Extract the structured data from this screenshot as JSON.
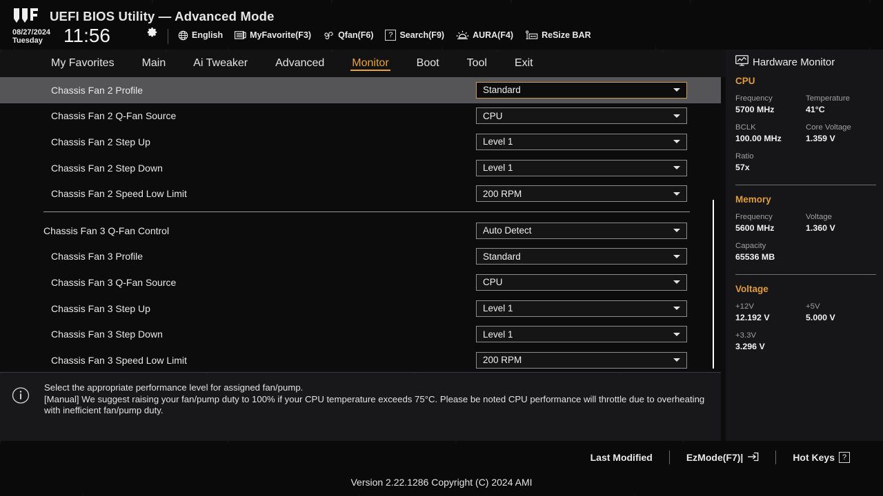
{
  "header": {
    "logo": "tuf-logo",
    "title": "UEFI BIOS Utility — Advanced Mode",
    "date": "08/27/2024",
    "day": "Tuesday",
    "time": "11:56",
    "gear_icon": "gear-icon",
    "items": [
      {
        "icon": "globe-icon",
        "label": "English"
      },
      {
        "icon": "list-icon",
        "label": "MyFavorite(F3)"
      },
      {
        "icon": "fan-icon",
        "label": "Qfan(F6)"
      },
      {
        "icon": "question-icon",
        "label": "Search(F9)"
      },
      {
        "icon": "aura-icon",
        "label": "AURA(F4)"
      },
      {
        "icon": "resizebar-icon",
        "label": "ReSize BAR"
      }
    ]
  },
  "nav": {
    "tabs": [
      {
        "label": "My Favorites",
        "active": false
      },
      {
        "label": "Main",
        "active": false
      },
      {
        "label": "Ai Tweaker",
        "active": false
      },
      {
        "label": "Advanced",
        "active": false
      },
      {
        "label": "Monitor",
        "active": true
      },
      {
        "label": "Boot",
        "active": false
      },
      {
        "label": "Tool",
        "active": false
      },
      {
        "label": "Exit",
        "active": false
      }
    ],
    "active_color": "#e8a33d"
  },
  "settings": {
    "group1": [
      {
        "label": "Chassis Fan 2 Profile",
        "value": "Standard",
        "indent": 1,
        "selected": true
      },
      {
        "label": "Chassis Fan 2 Q-Fan Source",
        "value": "CPU",
        "indent": 1,
        "selected": false
      },
      {
        "label": "Chassis Fan 2 Step Up",
        "value": "Level 1",
        "indent": 1,
        "selected": false
      },
      {
        "label": "Chassis Fan 2 Step Down",
        "value": "Level 1",
        "indent": 1,
        "selected": false
      },
      {
        "label": "Chassis Fan 2 Speed Low Limit",
        "value": "200 RPM",
        "indent": 1,
        "selected": false
      }
    ],
    "group2": [
      {
        "label": "Chassis Fan 3 Q-Fan Control",
        "value": "Auto Detect",
        "indent": 0,
        "selected": false
      },
      {
        "label": "Chassis Fan 3 Profile",
        "value": "Standard",
        "indent": 1,
        "selected": false
      },
      {
        "label": "Chassis Fan 3 Q-Fan Source",
        "value": "CPU",
        "indent": 1,
        "selected": false
      },
      {
        "label": "Chassis Fan 3 Step Up",
        "value": "Level 1",
        "indent": 1,
        "selected": false
      },
      {
        "label": "Chassis Fan 3 Step Down",
        "value": "Level 1",
        "indent": 1,
        "selected": false
      },
      {
        "label": "Chassis Fan 3 Speed Low Limit",
        "value": "200 RPM",
        "indent": 1,
        "selected": false
      }
    ],
    "selected_border_color": "#c79a5e"
  },
  "help": {
    "icon": "info-icon",
    "line1": "Select the appropriate performance level for assigned fan/pump.",
    "line2": "[Manual] We suggest raising your fan/pump duty to 100% if your CPU temperature exceeds 75°C. Please be noted CPU performance will throttle due to overheating with inefficient fan/pump duty."
  },
  "hardware_monitor": {
    "icon": "monitor-icon",
    "title": "Hardware Monitor",
    "accent_color": "#e09b3d",
    "sections": [
      {
        "name": "CPU",
        "metrics": [
          {
            "key": "Frequency",
            "value": "5700 MHz",
            "full": false
          },
          {
            "key": "Temperature",
            "value": "41°C",
            "full": false
          },
          {
            "key": "BCLK",
            "value": "100.00 MHz",
            "full": false
          },
          {
            "key": "Core Voltage",
            "value": "1.359 V",
            "full": false
          },
          {
            "key": "Ratio",
            "value": "57x",
            "full": true
          }
        ]
      },
      {
        "name": "Memory",
        "metrics": [
          {
            "key": "Frequency",
            "value": "5600 MHz",
            "full": false
          },
          {
            "key": "Voltage",
            "value": "1.360 V",
            "full": false
          },
          {
            "key": "Capacity",
            "value": "65536 MB",
            "full": true
          }
        ]
      },
      {
        "name": "Voltage",
        "metrics": [
          {
            "key": "+12V",
            "value": "12.192 V",
            "full": false
          },
          {
            "key": "+5V",
            "value": "5.000 V",
            "full": false
          },
          {
            "key": "+3.3V",
            "value": "3.296 V",
            "full": true
          }
        ]
      }
    ]
  },
  "footer": {
    "last_modified": "Last Modified",
    "ezmode": "EzMode(F7)|",
    "ezmode_icon": "arrow-into-box-icon",
    "hotkeys": "Hot Keys",
    "hotkeys_key": "?",
    "version": "Version 2.22.1286 Copyright (C) 2024 AMI"
  }
}
